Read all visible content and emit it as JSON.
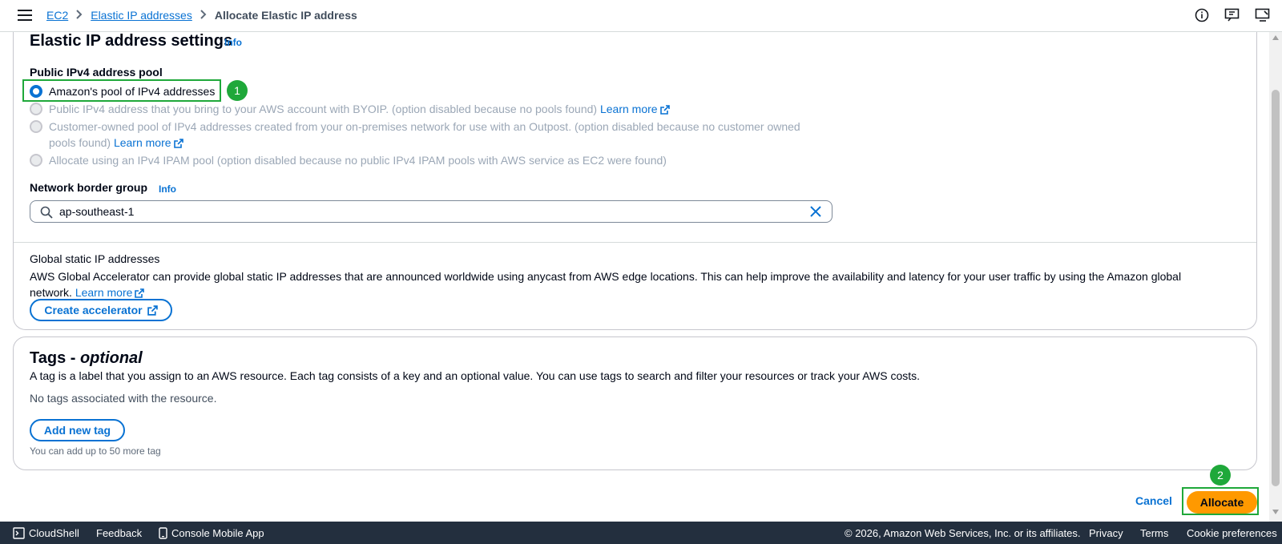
{
  "header": {
    "breadcrumbs": [
      "EC2",
      "Elastic IP addresses",
      "Allocate Elastic IP address"
    ],
    "icons": [
      "info-circle-icon",
      "feedback-icon",
      "notifications-icon"
    ]
  },
  "settings": {
    "title": "Elastic IP address settings",
    "info_label": "Info",
    "pool_label": "Public IPv4 address pool",
    "options": [
      {
        "label": "Amazon's pool of IPv4 addresses",
        "selected": true,
        "disabled": false
      },
      {
        "label": "Public IPv4 address that you bring to your AWS account with BYOIP. (option disabled because no pools found)",
        "selected": false,
        "disabled": true,
        "link": "Learn more"
      },
      {
        "label_line1": "Customer-owned pool of IPv4 addresses created from your on-premises network for use with an Outpost. (option disabled because no customer owned",
        "label_line2": "pools found)",
        "selected": false,
        "disabled": true,
        "link": "Learn more"
      },
      {
        "label": "Allocate using an IPv4 IPAM pool (option disabled because no public IPv4 IPAM pools with AWS service as EC2 were found)",
        "selected": false,
        "disabled": true
      }
    ],
    "border_group_label": "Network border group",
    "border_group_info": "Info",
    "border_group_value": "ap-southeast-1",
    "global": {
      "title": "Global static IP addresses",
      "description": "AWS Global Accelerator can provide global static IP addresses that are announced worldwide using anycast from AWS edge locations. This can help improve the availability and latency for your user traffic by using the Amazon global network.",
      "link": "Learn more",
      "button": "Create accelerator"
    }
  },
  "tags": {
    "title_main": "Tags - ",
    "title_optional": "optional",
    "description": "A tag is a label that you assign to an AWS resource. Each tag consists of a key and an optional value. You can use tags to search and filter your resources or track your AWS costs.",
    "empty": "No tags associated with the resource.",
    "add_button": "Add new tag",
    "limit": "You can add up to 50 more tag"
  },
  "actions": {
    "cancel": "Cancel",
    "allocate": "Allocate"
  },
  "annotations": {
    "step1": "1",
    "step2": "2",
    "color": "#1fa83a"
  },
  "footer": {
    "cloudshell": "CloudShell",
    "feedback": "Feedback",
    "mobile_app": "Console Mobile App",
    "copyright": "© 2026, Amazon Web Services, Inc. or its affiliates.",
    "privacy": "Privacy",
    "terms": "Terms",
    "cookies": "Cookie preferences"
  },
  "colors": {
    "link": "#0972d3",
    "primary": "#ff9900",
    "footer_bg": "#232f3e"
  }
}
